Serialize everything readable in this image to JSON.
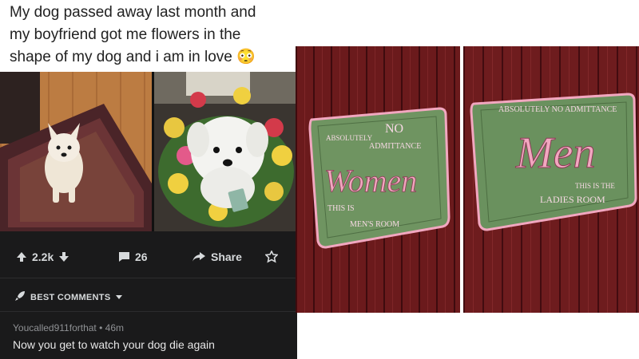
{
  "post": {
    "caption_lines": [
      "My dog passed away last month and",
      "my boyfriend got me flowers in the",
      "shape of my dog and i am in love 😳"
    ],
    "upvotes": "2.2k",
    "comments_count": "26",
    "share_label": "Share",
    "best_comments_label": "BEST COMMENTS",
    "comment_user": "Youcalled911forthat",
    "comment_age": "46m",
    "comment_text": "Now you get to watch your dog die again"
  },
  "signs": {
    "left": {
      "line1": "ABSOLUTELY",
      "line2": "NO",
      "line3": "ADMITTANCE",
      "big": "Women",
      "line4": "THIS IS",
      "line5": "MEN'S ROOM"
    },
    "right": {
      "line1": "ABSOLUTELY NO ADMITTANCE",
      "big": "Men",
      "line2": "THIS IS THE",
      "line3": "LADIES ROOM"
    }
  },
  "colors": {
    "post_dark_bg": "#1a1a1b",
    "wood_red": "#6e1c1c",
    "sign_green": "#5e8a55",
    "sign_pink": "#f2a7c0"
  }
}
